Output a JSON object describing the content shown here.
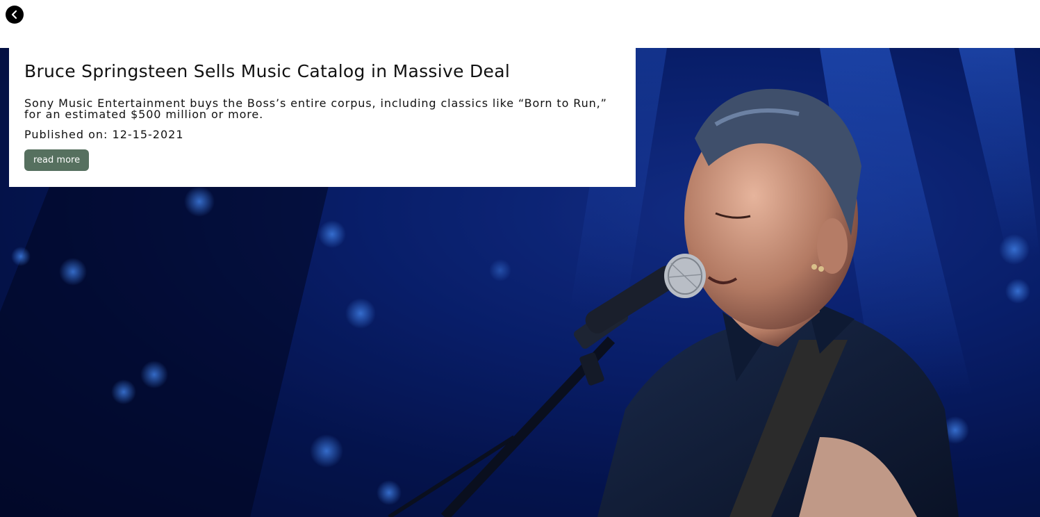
{
  "navigation": {
    "back_icon": "chevron-left-icon"
  },
  "article": {
    "headline": "Bruce Springsteen Sells Music Catalog in Massive Deal",
    "summary": "Sony Music Entertainment buys the Boss’s entire corpus, including classics like “Born to Run,” for an estimated $500 million or more.",
    "published_label": "Published on:",
    "published_date": "12-15-2021",
    "read_more_label": "read more"
  },
  "hero": {
    "description_icon": "photo-singer-at-microphone",
    "colors": {
      "background": "#0c2a8a",
      "button": "#56705f"
    }
  }
}
